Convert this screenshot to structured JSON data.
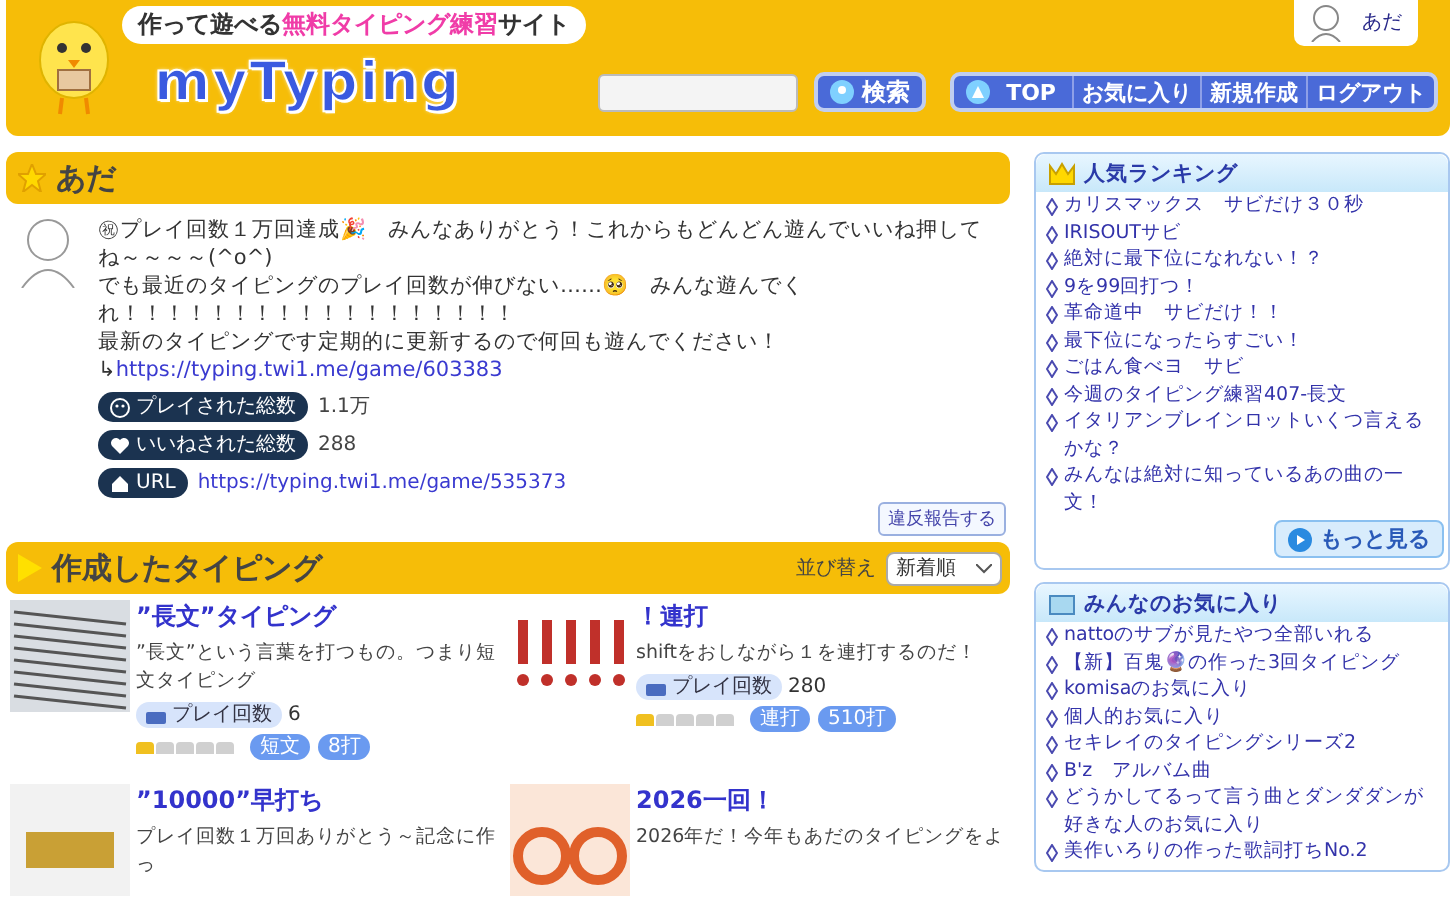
{
  "header": {
    "tagline": "作って遊べる**無料タイピング練習**サイト",
    "logo": "myTyping",
    "search": {
      "button": "検索"
    },
    "nav": [
      {
        "label": "TOP",
        "icon": true
      },
      {
        "label": "お気に入り",
        "icon": false
      },
      {
        "label": "新規作成",
        "icon": false
      },
      {
        "label": "ログアウト",
        "icon": false
      }
    ],
    "user": "あだ"
  },
  "profile": {
    "name": "あだ",
    "bio": [
      "㊗プレイ回数１万回達成🎉　みんなありがとう！これからもどんどん遊んでいいね押してね～～～～(^o^)",
      "でも最近のタイピングのプレイ回数が伸びない……🥺　みんな遊んでくれ！！！！！！！！！！！！！！！！！！",
      "最新のタイピングです定期的に更新するので何回も遊んでください！"
    ],
    "bio_link_prefix": "↳",
    "bio_link": "https://typing.twi1.me/game/603383",
    "stats": [
      {
        "kind": "plays",
        "label": "プレイされた総数",
        "value": "1.1万"
      },
      {
        "kind": "likes",
        "label": "いいねされた総数",
        "value": "288"
      },
      {
        "kind": "url",
        "label": "URL",
        "value": "https://typing.twi1.me/game/535373"
      }
    ],
    "report": "違反報告する"
  },
  "games": {
    "title": "作成したタイピング",
    "sort_label": "並び替え",
    "sort_value": "新着順",
    "items": [
      {
        "kind": "text-photo",
        "title": "”長文”タイピング",
        "desc": "”長文”という言葉を打つもの。つまり短文タイピング",
        "plays_label": "プレイ回数",
        "plays": "6",
        "stars": 1,
        "tags": [
          "短文",
          "8打"
        ]
      },
      {
        "kind": "marks",
        "title": "！連打",
        "desc": "shiftをおしながら１を連打するのだ！",
        "plays_label": "プレイ回数",
        "plays": "280",
        "stars": 1,
        "tags": [
          "連打",
          "510打"
        ]
      },
      {
        "kind": "number",
        "title": "”10000”早打ち",
        "desc": "プレイ回数１万回ありがとう～記念に作っ"
      },
      {
        "kind": "year",
        "title": "2026一回！",
        "desc": "2026年だ！今年もあだのタイピングをよ"
      }
    ]
  },
  "ranking": {
    "title": "人気ランキング",
    "items": [
      "カリスマックス　サビだけ３０秒",
      "IRISOUTサビ",
      "絶対に最下位になれない！？",
      "9を99回打つ！",
      "革命道中　サビだけ！！",
      "最下位になったらすごい！",
      "ごはん食べヨ　サビ",
      "今週のタイピング練習407-長文",
      "イタリアンブレインロットいくつ言えるかな？",
      "みんなは絶対に知っているあの曲の一文！"
    ],
    "more": "もっと見る"
  },
  "favorites": {
    "title": "みんなのお気に入り",
    "items": [
      "nattoのサブが見たやつ全部いれる",
      "【新】百鬼🔮の作った3回タイピング",
      "komisaのお気に入り",
      "個人的お気に入り",
      "セキレイのタイピングシリーズ2",
      "B'z　アルバム曲",
      "どうかしてるって言う曲とダンダダンが好きな人のお気に入り",
      "美作いろりの作った歌詞打ちNo.2"
    ]
  }
}
